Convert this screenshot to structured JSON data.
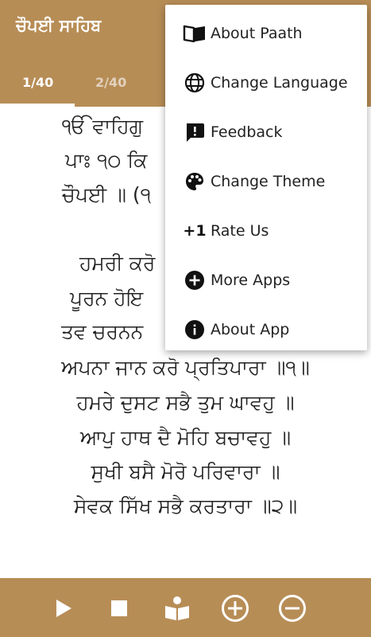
{
  "header": {
    "title": "ਚੌਪਈ ਸਾਹਿਬ",
    "tabs": [
      {
        "label": "1/40",
        "active": true
      },
      {
        "label": "2/40",
        "active": false
      }
    ]
  },
  "content": {
    "lines": [
      "ੴ ਵਾਹਿਗੁ",
      "ਪਾਃ ੧੦ ਕਿ",
      "ਚੌਪਈ ॥ (੧",
      "ਹਮਰੀ ਕਰੋ",
      "ਪੂਰਨ ਹੋਇ",
      "ਤਵ ਚਰਨਨ",
      "ਅਪਨਾ ਜਾਨ ਕਰੋ ਪ੍ਰਤਿਪਾਰਾ ॥੧॥",
      "ਹਮਰੇ ਦੁਸਟ ਸਭੈ ਤੁਮ ਘਾਵਹੁ ॥",
      "ਆਪੁ ਹਾਥ ਦੈ ਮੋਹਿ ਬਚਾਵਹੁ ॥",
      "ਸੁਖੀ ਬਸੈ ਮੋਰੋ ਪਰਿਵਾਰਾ ॥",
      "ਸੇਵਕ ਸਿੱਖ ਸਭੈ ਕਰਤਾਰਾ ॥੨॥"
    ]
  },
  "menu": {
    "items": [
      {
        "label": "About Paath",
        "icon": "book-icon"
      },
      {
        "label": "Change Language",
        "icon": "globe-icon"
      },
      {
        "label": "Feedback",
        "icon": "feedback-icon"
      },
      {
        "label": "Change Theme",
        "icon": "palette-icon"
      },
      {
        "label": "Rate Us",
        "icon": "plus-one-icon",
        "icon_text": "+1"
      },
      {
        "label": "More Apps",
        "icon": "add-circle-icon"
      },
      {
        "label": "About App",
        "icon": "info-icon"
      }
    ]
  },
  "bottom_bar": {
    "buttons": [
      "play-icon",
      "stop-icon",
      "reader-icon",
      "zoom-in-icon",
      "zoom-out-icon"
    ]
  },
  "colors": {
    "accent": "#b78d56",
    "text": "#222222",
    "menu_bg": "#ffffff"
  }
}
